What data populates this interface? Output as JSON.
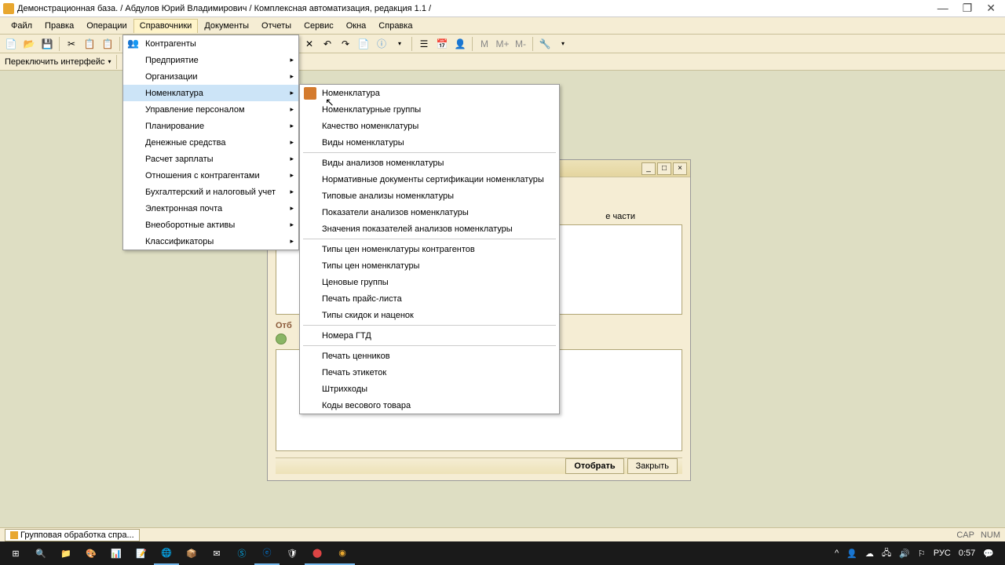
{
  "title": "Демонстрационная база. / Абдулов Юрий Владимирович / Комплексная автоматизация, редакция 1.1 /",
  "menubar": [
    "Файл",
    "Правка",
    "Операции",
    "Справочники",
    "Документы",
    "Отчеты",
    "Сервис",
    "Окна",
    "Справка"
  ],
  "switch_label": "Переключить интерфейс",
  "menu1": {
    "items": [
      {
        "label": "Контрагенты",
        "icon": "👥",
        "arrow": false
      },
      {
        "label": "Предприятие",
        "arrow": true
      },
      {
        "label": "Организации",
        "arrow": true
      },
      {
        "label": "Номенклатура",
        "arrow": true,
        "hl": true
      },
      {
        "label": "Управление персоналом",
        "arrow": true
      },
      {
        "label": "Планирование",
        "arrow": true
      },
      {
        "label": "Денежные средства",
        "arrow": true
      },
      {
        "label": "Расчет зарплаты",
        "arrow": true
      },
      {
        "label": "Отношения с контрагентами",
        "arrow": true
      },
      {
        "label": "Бухгалтерский и налоговый учет",
        "arrow": true
      },
      {
        "label": "Электронная почта",
        "arrow": true
      },
      {
        "label": "Внеоборотные активы",
        "arrow": true
      },
      {
        "label": "Классификаторы",
        "arrow": true
      }
    ]
  },
  "menu2": {
    "groups": [
      [
        "Номенклатура",
        "Номенклатурные группы",
        "Качество номенклатуры",
        "Виды номенклатуры"
      ],
      [
        "Виды анализов номенклатуры",
        "Нормативные документы сертификации номенклатуры",
        "Типовые анализы номенклатуры",
        "Показатели анализов номенклатуры",
        "Значения показателей анализов номенклатуры"
      ],
      [
        "Типы цен номенклатуры контрагентов",
        "Типы цен номенклатуры",
        "Ценовые группы",
        "Печать прайс-листа",
        "Типы скидок и наценок"
      ],
      [
        "Номера ГТД"
      ],
      [
        "Печать ценников",
        "Печать этикеток",
        "Штрихкоды",
        "Коды весового товара"
      ]
    ],
    "icon0": true
  },
  "inner": {
    "partial_text": "е части",
    "section_label": "Отб",
    "btn_select": "Отобрать",
    "btn_close": "Закрыть"
  },
  "status_tab": "Групповая обработка спра...",
  "status_caps": "CAP",
  "status_num": "NUM",
  "tray": {
    "lang": "РУС",
    "time": "0:57"
  }
}
